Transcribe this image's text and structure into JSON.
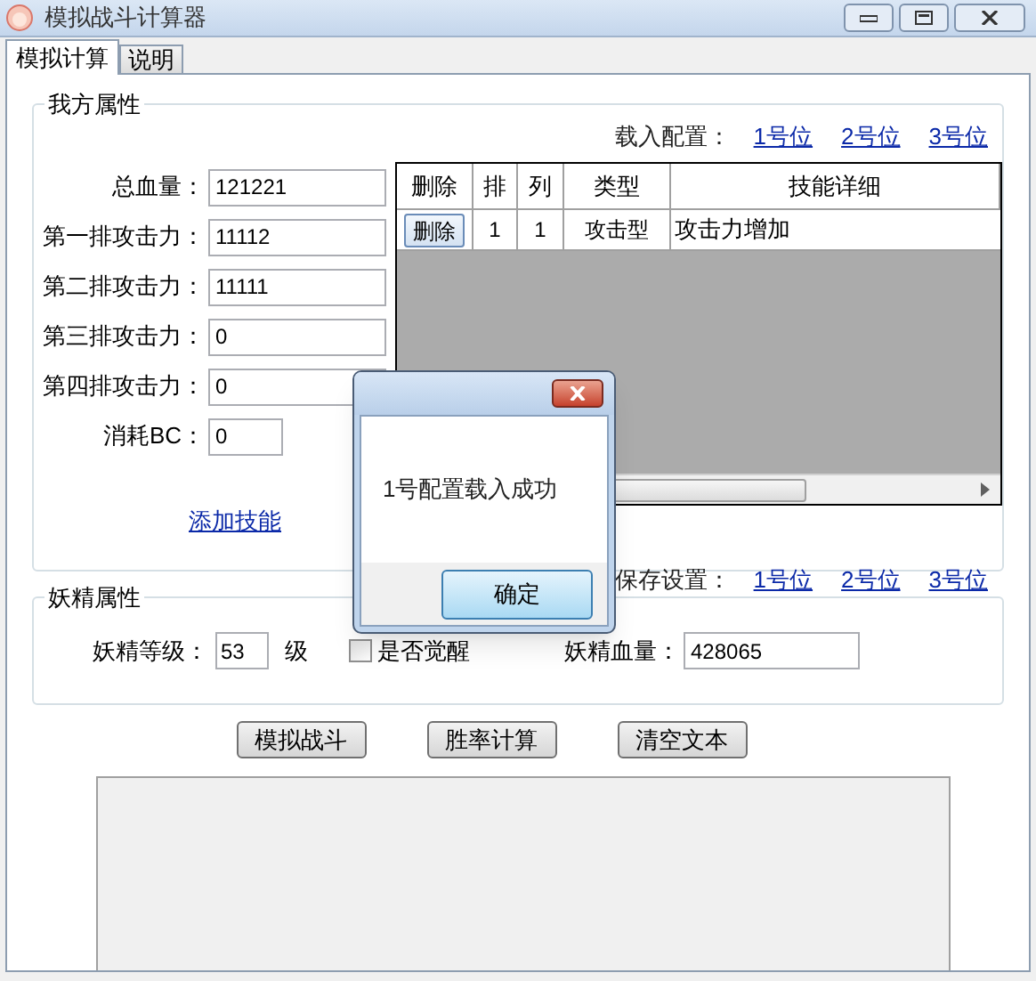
{
  "window": {
    "title": "模拟战斗计算器"
  },
  "tabs": [
    {
      "label": "模拟计算",
      "selected": true
    },
    {
      "label": "说明",
      "selected": false
    }
  ],
  "own_group": {
    "title": "我方属性",
    "load_label": "载入配置：",
    "load_links": [
      "1号位",
      "2号位",
      "3号位"
    ],
    "fields": [
      {
        "label": "总血量：",
        "value": "121221",
        "kind": "wide"
      },
      {
        "label": "第一排攻击力：",
        "value": "11112",
        "kind": "wide"
      },
      {
        "label": "第二排攻击力：",
        "value": "11111",
        "kind": "wide"
      },
      {
        "label": "第三排攻击力：",
        "value": "0",
        "kind": "wide"
      },
      {
        "label": "第四排攻击力：",
        "value": "0",
        "kind": "wide"
      },
      {
        "label": "消耗BC：",
        "value": "0",
        "kind": "narrow"
      }
    ],
    "add_skill_link": "添加技能",
    "table": {
      "columns": [
        "删除",
        "排",
        "列",
        "类型",
        "技能详细"
      ],
      "rows": [
        {
          "delete_button": "删除",
          "row": "1",
          "column": "1",
          "type": "攻击型",
          "detail": "攻击力增加"
        }
      ]
    },
    "save_label": "保存设置：",
    "save_links": [
      "1号位",
      "2号位",
      "3号位"
    ]
  },
  "fairy_group": {
    "title": "妖精属性",
    "level_label": "妖精等级：",
    "level_value": "53",
    "level_unit": "级",
    "awaken": {
      "label": "是否觉醒",
      "checked": false
    },
    "hp_label": "妖精血量：",
    "hp_value": "428065"
  },
  "buttons": [
    "模拟战斗",
    "胜率计算",
    "清空文本"
  ],
  "dialog": {
    "message": "1号配置载入成功",
    "button": "确定"
  }
}
